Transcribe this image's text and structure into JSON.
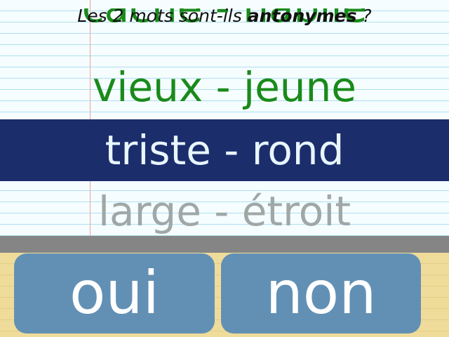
{
  "question": {
    "prefix": "Les 2 mots sont-ils ",
    "keyword": "antonymes",
    "suffix": " ?"
  },
  "word_pairs": {
    "previous_answered": "caché - habile",
    "answered": "vieux - jeune",
    "current": "triste - rond",
    "upcoming": "large - étroit"
  },
  "buttons": {
    "yes_label": "oui",
    "no_label": "non"
  },
  "colors": {
    "answered_text": "#1a8a1a",
    "current_background": "#1b2d6b",
    "current_text": "#e8f6ff",
    "upcoming_text": "#a0a7a7",
    "button_background": "#6290b5"
  }
}
